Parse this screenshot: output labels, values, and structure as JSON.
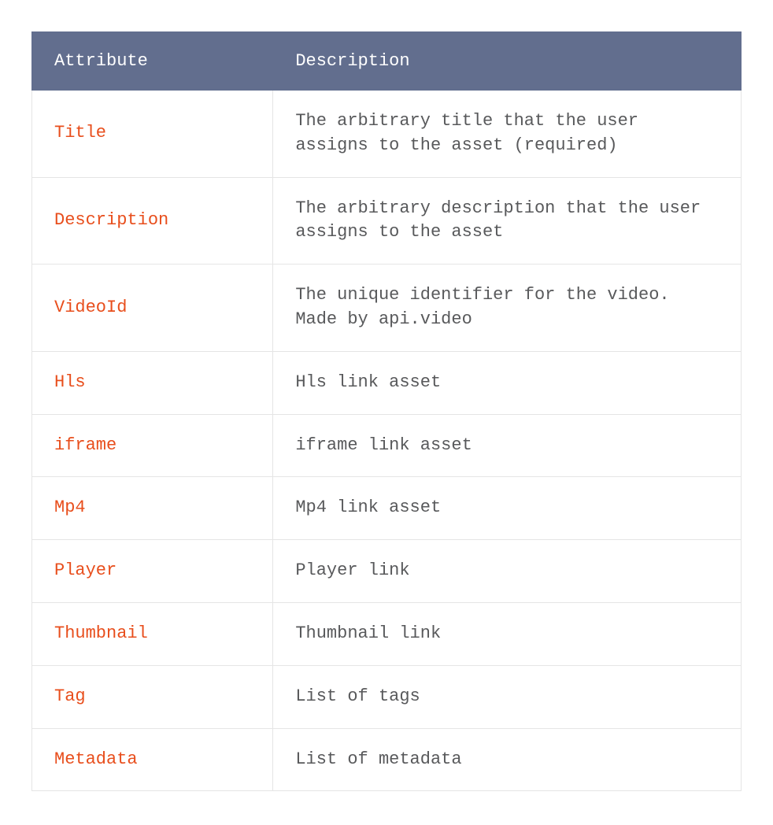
{
  "table": {
    "headers": {
      "attribute": "Attribute",
      "description": "Description"
    },
    "rows": [
      {
        "attribute": "Title",
        "description": "The arbitrary title that the user assigns to the asset (required)"
      },
      {
        "attribute": "Description",
        "description": "The arbitrary description that the user assigns to the asset"
      },
      {
        "attribute": "VideoId",
        "description": "The unique identifier for the video. Made by api.video"
      },
      {
        "attribute": "Hls",
        "description": "Hls link asset"
      },
      {
        "attribute": "iframe",
        "description": "iframe link asset"
      },
      {
        "attribute": "Mp4",
        "description": "Mp4 link asset"
      },
      {
        "attribute": "Player",
        "description": "Player link"
      },
      {
        "attribute": "Thumbnail",
        "description": "Thumbnail link"
      },
      {
        "attribute": "Tag",
        "description": "List of tags"
      },
      {
        "attribute": "Metadata",
        "description": "List of metadata"
      }
    ]
  }
}
